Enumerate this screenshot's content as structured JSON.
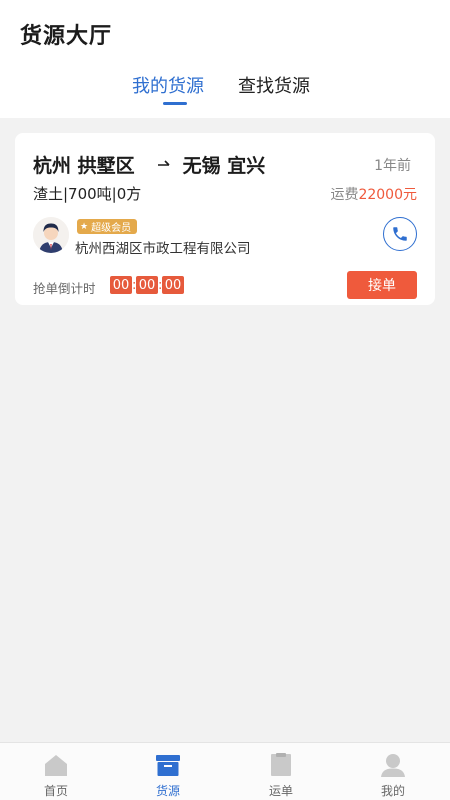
{
  "header": {
    "title": "货源大厅",
    "tabs": [
      {
        "label": "我的货源",
        "active": true
      },
      {
        "label": "查找货源",
        "active": false
      }
    ]
  },
  "card": {
    "origin": "杭州 拱墅区",
    "arrow": "→",
    "destination": "无锡 宜兴",
    "time_ago": "1年前",
    "cargo": "渣土|700吨|0方",
    "fee_label": "运费",
    "fee_amount": "22000元",
    "vip_label": "超级会员",
    "company": "杭州西湖区市政工程有限公司",
    "countdown_label": "抢单倒计时",
    "countdown": {
      "h": "00",
      "m": "00",
      "s": "00"
    },
    "accept_label": "接单"
  },
  "tabbar": {
    "items": [
      {
        "label": "首页",
        "icon": "home-icon",
        "active": false
      },
      {
        "label": "货源",
        "icon": "box-icon",
        "active": true
      },
      {
        "label": "运单",
        "icon": "waybill-icon",
        "active": false
      },
      {
        "label": "我的",
        "icon": "profile-icon",
        "active": false
      }
    ]
  },
  "colors": {
    "accent": "#2f6fd0",
    "danger": "#ef5a3c",
    "vip": "#e4a94b",
    "background": "#f2f2f2"
  }
}
